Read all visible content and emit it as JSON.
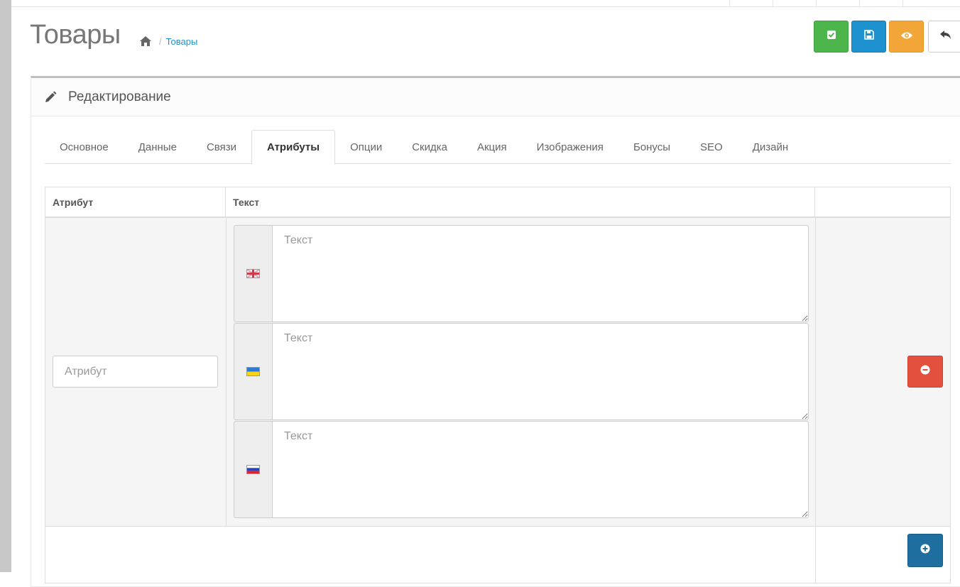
{
  "page": {
    "title": "Товары",
    "breadcrumb": [
      "Товары"
    ]
  },
  "toolbar": {
    "buttons": [
      {
        "icon": "check-square-icon",
        "color": "#4cb64c"
      },
      {
        "icon": "save-icon",
        "color": "#1e91cf"
      },
      {
        "icon": "eye-icon",
        "color": "#f3a638"
      },
      {
        "icon": "reply-icon",
        "color": "#ffffff"
      }
    ]
  },
  "panel": {
    "title": "Редактирование",
    "tabs": [
      {
        "label": "Основное",
        "active": false
      },
      {
        "label": "Данные",
        "active": false
      },
      {
        "label": "Связи",
        "active": false
      },
      {
        "label": "Атрибуты",
        "active": true
      },
      {
        "label": "Опции",
        "active": false
      },
      {
        "label": "Скидка",
        "active": false
      },
      {
        "label": "Акция",
        "active": false
      },
      {
        "label": "Изображения",
        "active": false
      },
      {
        "label": "Бонусы",
        "active": false
      },
      {
        "label": "SEO",
        "active": false
      },
      {
        "label": "Дизайн",
        "active": false
      }
    ]
  },
  "attributes": {
    "headers": [
      "Атрибут",
      "Текст",
      ""
    ],
    "attribute_placeholder": "Атрибут",
    "attribute_value": "",
    "languages": [
      {
        "flag": "gb-flag-icon",
        "placeholder": "Текст",
        "value": ""
      },
      {
        "flag": "ua-flag-icon",
        "placeholder": "Текст",
        "value": ""
      },
      {
        "flag": "ru-flag-icon",
        "placeholder": "Текст",
        "value": ""
      }
    ]
  },
  "colors": {
    "accent_blue": "#1e91cf",
    "danger": "#e3503e",
    "success": "#4cb64c",
    "warning": "#f3a638",
    "primary_dark": "#1e6fa0"
  }
}
